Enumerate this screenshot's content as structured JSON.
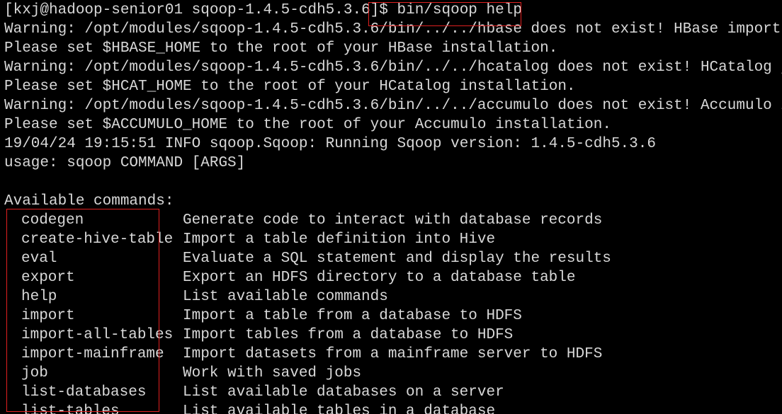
{
  "terminal": {
    "prompt": "[kxj@hadoop-senior01 sqoop-1.4.5-cdh5.3.6]$",
    "command": " bin/sqoop help",
    "output_lines": [
      "Warning: /opt/modules/sqoop-1.4.5-cdh5.3.6/bin/../../hbase does not exist! HBase imports will fail.",
      "Please set $HBASE_HOME to the root of your HBase installation.",
      "Warning: /opt/modules/sqoop-1.4.5-cdh5.3.6/bin/../../hcatalog does not exist! HCatalog jobs will fail.",
      "Please set $HCAT_HOME to the root of your HCatalog installation.",
      "Warning: /opt/modules/sqoop-1.4.5-cdh5.3.6/bin/../../accumulo does not exist! Accumulo imports will fail.",
      "Please set $ACCUMULO_HOME to the root of your Accumulo installation.",
      "19/04/24 19:15:51 INFO sqoop.Sqoop: Running Sqoop version: 1.4.5-cdh5.3.6",
      "usage: sqoop COMMAND [ARGS]",
      "",
      "Available commands:"
    ],
    "commands": [
      {
        "name": "codegen",
        "description": "Generate code to interact with database records"
      },
      {
        "name": "create-hive-table",
        "description": "Import a table definition into Hive"
      },
      {
        "name": "eval",
        "description": "Evaluate a SQL statement and display the results"
      },
      {
        "name": "export",
        "description": "Export an HDFS directory to a database table"
      },
      {
        "name": "help",
        "description": "List available commands"
      },
      {
        "name": "import",
        "description": "Import a table from a database to HDFS"
      },
      {
        "name": "import-all-tables",
        "description": "Import tables from a database to HDFS"
      },
      {
        "name": "import-mainframe",
        "description": "Import datasets from a mainframe server to HDFS"
      },
      {
        "name": "job",
        "description": "Work with saved jobs"
      },
      {
        "name": "list-databases",
        "description": "List available databases on a server"
      },
      {
        "name": "list-tables",
        "description": "List available tables in a database"
      }
    ],
    "colors": {
      "background": "#000000",
      "text": "#d8d8d8",
      "highlight_box": "#e02020"
    }
  }
}
